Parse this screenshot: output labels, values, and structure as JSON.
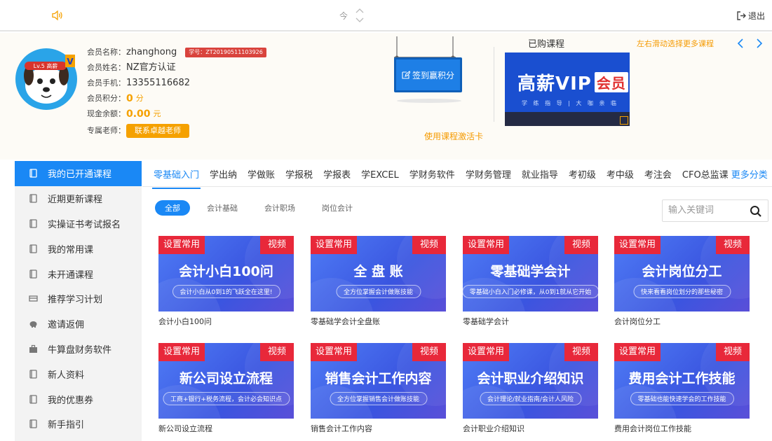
{
  "topbar": {
    "center_text": "今",
    "logout_label": "退出"
  },
  "profile": {
    "level_badge": "Lv.5 高薪",
    "member_name_label": "会员名称：",
    "member_name": "zhanghong",
    "student_id": "学号：ZT20190511103926",
    "member_realname_label": "会员姓名：",
    "member_realname": "NZ官方认证",
    "phone_label": "会员手机：",
    "phone": "13355116682",
    "points_label": "会员积分：",
    "points": "0",
    "points_unit": "分",
    "balance_label": "现金余额：",
    "balance": "0.00",
    "balance_unit": "元",
    "teacher_label": "专属老师：",
    "teacher_button": "联系卓越老师"
  },
  "signin": {
    "label": "签到赢积分"
  },
  "activate_link": "使用课程激活卡",
  "bought": {
    "title": "已购课程",
    "hint": "左右滑动选择更多课程",
    "vip_title": "高薪VIP",
    "vip_tag": "会员",
    "vip_sub": "学 练 指 导 | 大 咖 亲 临"
  },
  "sidebar": {
    "items": [
      {
        "label": "我的已开通课程",
        "icon": "book-icon"
      },
      {
        "label": "近期更新课程",
        "icon": "book-icon"
      },
      {
        "label": "实操证书考试报名",
        "icon": "book-icon"
      },
      {
        "label": "我的常用课",
        "icon": "book-icon"
      },
      {
        "label": "未开通课程",
        "icon": "book-icon"
      },
      {
        "label": "推荐学习计划",
        "icon": "plan-icon"
      },
      {
        "label": "邀请返佣",
        "icon": "piggy-bank-icon"
      },
      {
        "label": "牛算盘财务软件",
        "icon": "briefcase-icon"
      },
      {
        "label": "新人资料",
        "icon": "book-icon"
      },
      {
        "label": "我的优惠券",
        "icon": "book-icon"
      },
      {
        "label": "新手指引",
        "icon": "book-icon"
      }
    ]
  },
  "categories": [
    "零基础入门",
    "学出纳",
    "学做账",
    "学报税",
    "学报表",
    "学EXCEL",
    "学财务软件",
    "学财务管理",
    "就业指导",
    "考初级",
    "考中级",
    "考注会",
    "CFO总监课"
  ],
  "more_categories": "更多分类",
  "filters": [
    "全部",
    "会计基础",
    "会计职场",
    "岗位会计"
  ],
  "search": {
    "placeholder": "输入关键词"
  },
  "courses": [
    {
      "tag_left": "设置常用",
      "tag_right": "视频",
      "thumb_title": "会计小白100问",
      "thumb_sub": "会计小白从0到1的飞跃全在这里!",
      "name": "会计小白100问"
    },
    {
      "tag_left": "设置常用",
      "tag_right": "视频",
      "thumb_title": "全 盘 账",
      "thumb_sub": "全方位掌握会计做账技能",
      "name": "零基础学会计全盘账"
    },
    {
      "tag_left": "设置常用",
      "tag_right": "视频",
      "thumb_title": "零基础学会计",
      "thumb_sub": "零基础小白入门必修课，从0到1就从它开始",
      "name": "零基础学会计"
    },
    {
      "tag_left": "设置常用",
      "tag_right": "视频",
      "thumb_title": "会计岗位分工",
      "thumb_sub": "快来看看岗位划分的那些秘密",
      "name": "会计岗位分工"
    },
    {
      "tag_left": "设置常用",
      "tag_right": "视频",
      "thumb_title": "新公司设立流程",
      "thumb_sub": "工商+银行+税务流程，会计必会知识点",
      "name": "新公司设立流程"
    },
    {
      "tag_left": "设置常用",
      "tag_right": "视频",
      "thumb_title": "销售会计工作内容",
      "thumb_sub": "全方位掌握销售会计做账技能",
      "name": "销售会计工作内容"
    },
    {
      "tag_left": "设置常用",
      "tag_right": "视频",
      "thumb_title": "会计职业介绍知识",
      "thumb_sub": "会计理论/就业指南/会计人风险",
      "name": "会计职业介绍知识"
    },
    {
      "tag_left": "设置常用",
      "tag_right": "视频",
      "thumb_title": "费用会计工作技能",
      "thumb_sub": "零基础也能快速学会的工作技能",
      "name": "费用会计岗位工作技能"
    }
  ]
}
